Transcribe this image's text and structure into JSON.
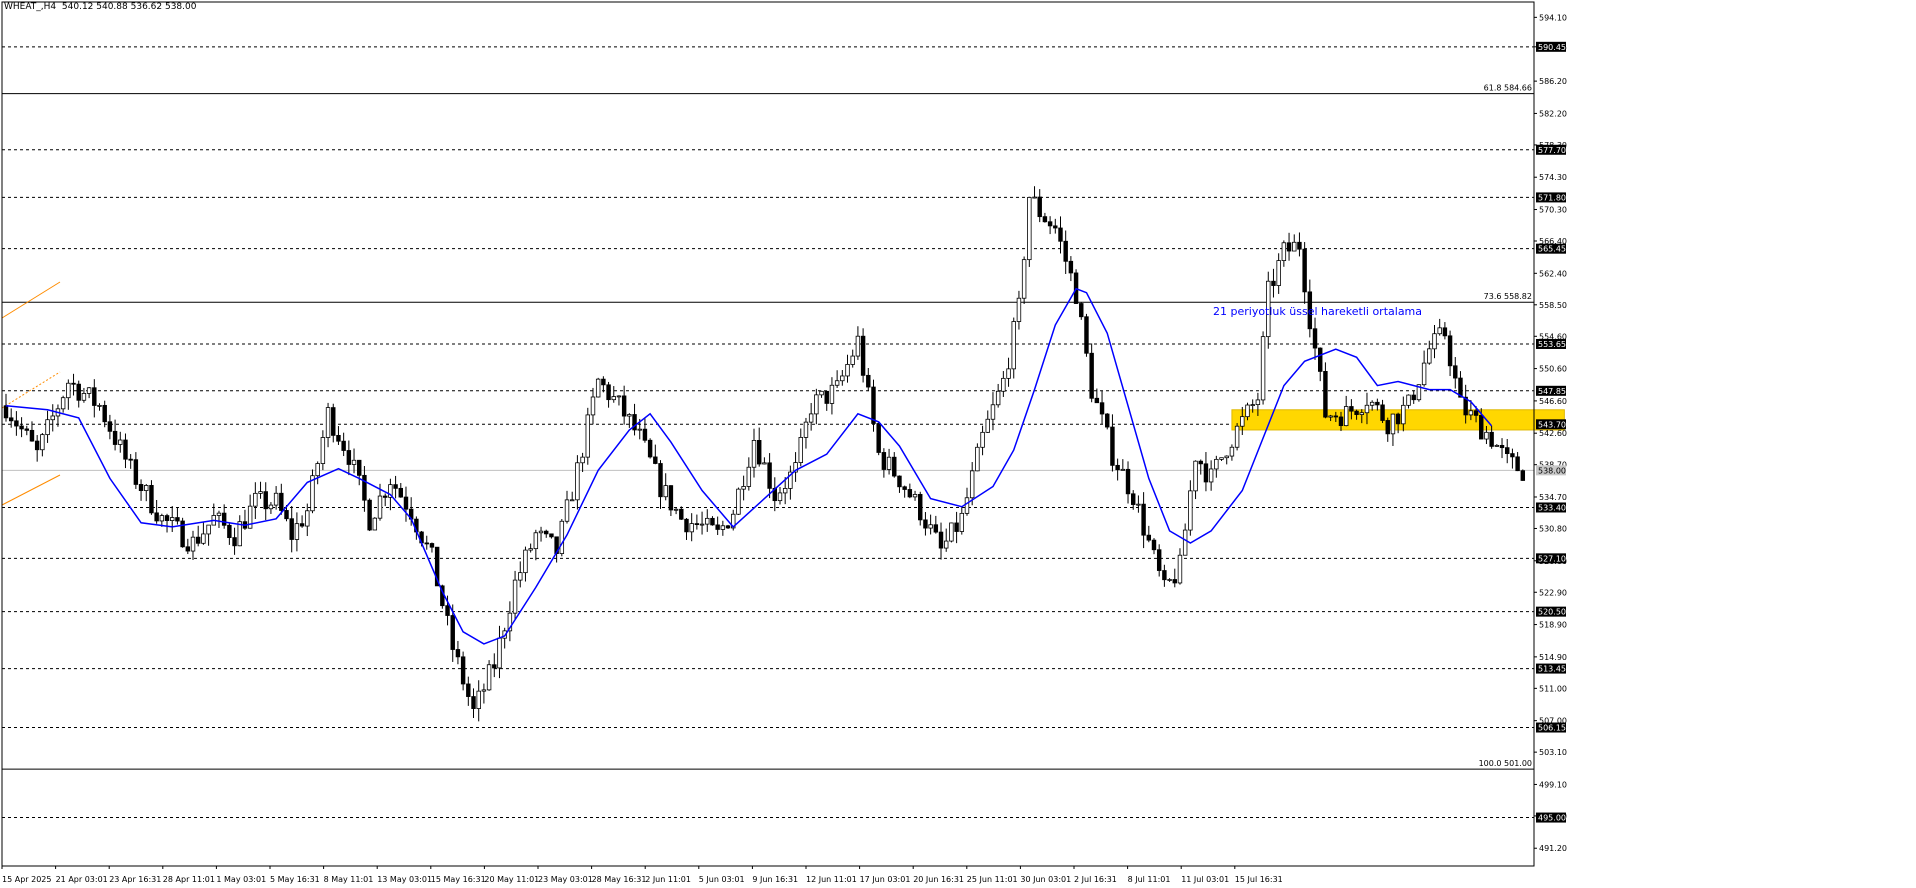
{
  "header": {
    "symbol": "WHEAT_,H4",
    "ohlc": "540.12 540.88 536.62 538.00"
  },
  "colors": {
    "background": "#ffffff",
    "candles": "#000000",
    "ema": "#0000ff",
    "zone": "#ffd700",
    "trendline": "#ff8c00",
    "current_price_line": "#c0c0c0"
  },
  "chart_data": {
    "type": "candlestick",
    "title": "",
    "ylim": [
      489.0,
      596.0
    ],
    "y_ticks": [
      "594.10",
      "590.45",
      "586.20",
      "582.20",
      "578.30",
      "574.30",
      "570.30",
      "566.40",
      "562.40",
      "558.50",
      "554.60",
      "550.60",
      "546.60",
      "542.60",
      "538.70",
      "534.70",
      "530.80",
      "526.80",
      "522.90",
      "518.90",
      "514.90",
      "511.00",
      "507.00",
      "503.10",
      "499.10",
      "495.20",
      "491.20"
    ],
    "x_tick_labels": [
      "15 Apr 2025",
      "21 Apr 03:01",
      "23 Apr 16:31",
      "28 Apr 11:01",
      "1 May 03:01",
      "5 May 16:31",
      "8 May 11:01",
      "13 May 03:01",
      "15 May 16:31",
      "20 May 11:01",
      "23 May 03:01",
      "28 May 16:31",
      "2 Jun 11:01",
      "5 Jun 03:01",
      "9 Jun 16:31",
      "12 Jun 11:01",
      "17 Jun 03:01",
      "20 Jun 16:31",
      "25 Jun 11:01",
      "30 Jun 03:01",
      "2 Jul 16:31",
      "8 Jul 11:01",
      "11 Jul 03:01",
      "15 Jul 16:31"
    ],
    "dashed_levels": [
      {
        "value": 590.45,
        "label": "590.45"
      },
      {
        "value": 577.7,
        "label": "577.70"
      },
      {
        "value": 571.8,
        "label": "571.80"
      },
      {
        "value": 565.45,
        "label": "565.45"
      },
      {
        "value": 553.65,
        "label": "553.65"
      },
      {
        "value": 547.85,
        "label": "547.85"
      },
      {
        "value": 543.7,
        "label": "543.70"
      },
      {
        "value": 533.4,
        "label": "533.40"
      },
      {
        "value": 527.1,
        "label": "527.10"
      },
      {
        "value": 520.5,
        "label": "520.50"
      },
      {
        "value": 513.45,
        "label": "513.45"
      },
      {
        "value": 506.15,
        "label": "506.15"
      },
      {
        "value": 495.0,
        "label": "495.00"
      }
    ],
    "fib_levels": [
      {
        "value": 584.66,
        "label": "61.8 584.66"
      },
      {
        "value": 558.82,
        "label": "73.6 558.82"
      },
      {
        "value": 501.0,
        "label": "100.0 501.00"
      }
    ],
    "current_price": {
      "value": 538.0,
      "label": "538.00"
    },
    "zone": {
      "low": 543.0,
      "high": 545.5
    },
    "annotation": "21 periyotluk üssel hareketli ortalama",
    "close_path": [
      [
        0,
        546.0
      ],
      [
        6,
        540.0
      ],
      [
        12,
        549.0
      ],
      [
        18,
        546.0
      ],
      [
        24,
        538.0
      ],
      [
        30,
        532.0
      ],
      [
        36,
        529.0
      ],
      [
        40,
        532.0
      ],
      [
        44,
        530.0
      ],
      [
        48,
        534.0
      ],
      [
        52,
        534.0
      ],
      [
        55,
        530.0
      ],
      [
        58,
        533.0
      ],
      [
        62,
        545.0
      ],
      [
        66,
        540.0
      ],
      [
        70,
        532.0
      ],
      [
        74,
        537.0
      ],
      [
        78,
        533.0
      ],
      [
        82,
        527.0
      ],
      [
        86,
        516.0
      ],
      [
        90,
        508.0
      ],
      [
        94,
        514.0
      ],
      [
        98,
        524.0
      ],
      [
        102,
        530.0
      ],
      [
        106,
        528.0
      ],
      [
        110,
        538.0
      ],
      [
        114,
        549.0
      ],
      [
        118,
        546.0
      ],
      [
        122,
        542.0
      ],
      [
        126,
        536.0
      ],
      [
        130,
        532.0
      ],
      [
        134,
        531.0
      ],
      [
        137,
        530.0
      ],
      [
        140,
        533.0
      ],
      [
        144,
        542.0
      ],
      [
        148,
        535.0
      ],
      [
        152,
        538.0
      ],
      [
        155,
        546.0
      ],
      [
        160,
        548.0
      ],
      [
        164,
        554.0
      ],
      [
        168,
        540.0
      ],
      [
        172,
        537.0
      ],
      [
        176,
        533.0
      ],
      [
        180,
        528.0
      ],
      [
        184,
        532.0
      ],
      [
        188,
        542.0
      ],
      [
        192,
        549.0
      ],
      [
        195,
        558.0
      ],
      [
        197,
        572.0
      ],
      [
        199,
        570.0
      ],
      [
        202,
        568.0
      ],
      [
        206,
        560.0
      ],
      [
        209,
        548.0
      ],
      [
        213,
        540.0
      ],
      [
        217,
        535.0
      ],
      [
        220,
        529.0
      ],
      [
        223,
        523.0
      ],
      [
        226,
        526.0
      ],
      [
        229,
        540.0
      ],
      [
        232,
        537.0
      ],
      [
        235,
        541.0
      ],
      [
        238,
        544.0
      ],
      [
        241,
        547.0
      ],
      [
        243,
        560.0
      ],
      [
        246,
        565.0
      ],
      [
        249,
        566.0
      ],
      [
        251,
        557.0
      ],
      [
        254,
        545.0
      ],
      [
        258,
        545.0
      ],
      [
        262,
        547.0
      ],
      [
        266,
        544.0
      ],
      [
        270,
        546.0
      ],
      [
        274,
        553.0
      ],
      [
        277,
        555.0
      ],
      [
        280,
        546.0
      ],
      [
        283,
        544.0
      ],
      [
        286,
        542.0
      ],
      [
        289,
        539.0
      ],
      [
        292,
        538.0
      ]
    ],
    "ema21": [
      [
        0,
        546.0
      ],
      [
        8,
        545.5
      ],
      [
        14,
        544.5
      ],
      [
        20,
        537.0
      ],
      [
        26,
        531.5
      ],
      [
        32,
        531.0
      ],
      [
        40,
        531.8
      ],
      [
        46,
        531.2
      ],
      [
        52,
        532.0
      ],
      [
        58,
        536.5
      ],
      [
        64,
        538.2
      ],
      [
        68,
        537.0
      ],
      [
        74,
        535.0
      ],
      [
        78,
        532.0
      ],
      [
        84,
        523.0
      ],
      [
        88,
        518.0
      ],
      [
        92,
        516.5
      ],
      [
        96,
        517.5
      ],
      [
        102,
        523.5
      ],
      [
        108,
        530.0
      ],
      [
        114,
        538.0
      ],
      [
        120,
        543.0
      ],
      [
        124,
        545.0
      ],
      [
        128,
        541.5
      ],
      [
        134,
        535.5
      ],
      [
        140,
        531.0
      ],
      [
        146,
        534.5
      ],
      [
        152,
        538.0
      ],
      [
        158,
        540.0
      ],
      [
        164,
        545.0
      ],
      [
        168,
        544.0
      ],
      [
        172,
        541.0
      ],
      [
        178,
        534.5
      ],
      [
        184,
        533.5
      ],
      [
        190,
        536.0
      ],
      [
        194,
        540.5
      ],
      [
        198,
        548.0
      ],
      [
        202,
        556.0
      ],
      [
        206,
        560.5
      ],
      [
        208,
        560.0
      ],
      [
        212,
        555.0
      ],
      [
        216,
        546.0
      ],
      [
        220,
        537.0
      ],
      [
        224,
        530.5
      ],
      [
        228,
        529.0
      ],
      [
        232,
        530.5
      ],
      [
        238,
        535.5
      ],
      [
        242,
        542.0
      ],
      [
        246,
        548.5
      ],
      [
        250,
        551.5
      ],
      [
        256,
        553.0
      ],
      [
        260,
        552.0
      ],
      [
        264,
        548.5
      ],
      [
        268,
        549.0
      ],
      [
        274,
        548.0
      ],
      [
        278,
        548.0
      ],
      [
        282,
        546.5
      ],
      [
        286,
        543.5
      ]
    ]
  }
}
